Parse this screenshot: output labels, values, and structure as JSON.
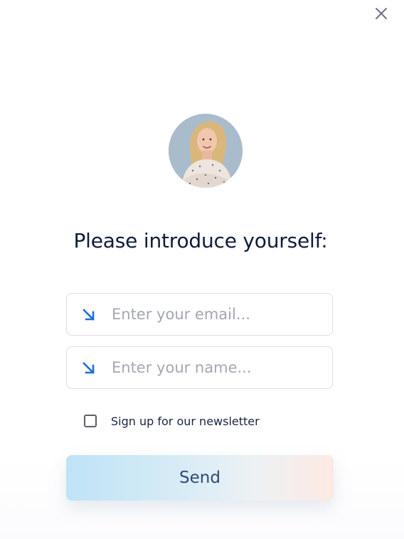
{
  "dialog": {
    "close_icon": "close-icon",
    "title": "Please introduce yourself:"
  },
  "form": {
    "email": {
      "icon": "arrow-down-right-icon",
      "placeholder": "Enter your email...",
      "value": ""
    },
    "name": {
      "icon": "arrow-down-right-icon",
      "placeholder": "Enter your name...",
      "value": ""
    },
    "newsletter": {
      "label": "Sign up for our newsletter",
      "checked": false
    },
    "send_label": "Send"
  },
  "colors": {
    "title": "#0f1b3a",
    "accent_arrow": "#1e6fd9",
    "send_text": "#2f4a78"
  }
}
